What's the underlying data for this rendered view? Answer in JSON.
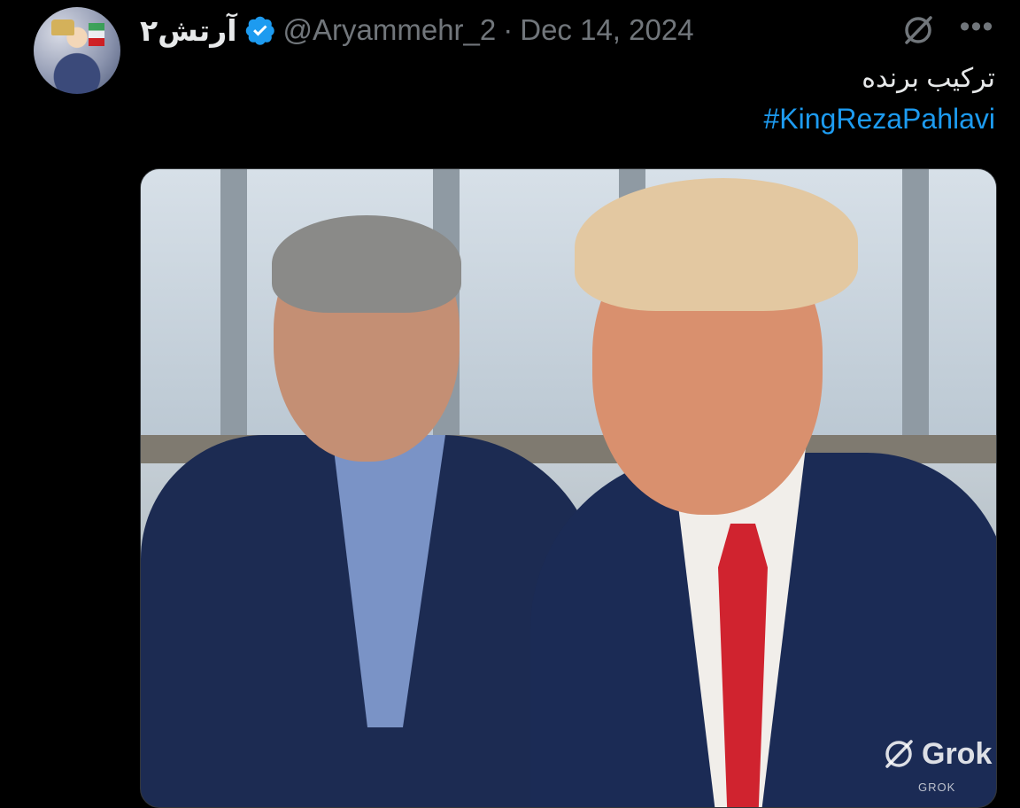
{
  "tweet": {
    "display_name": "آرتش۲",
    "handle": "@Aryammehr_2",
    "separator": "·",
    "date": "Dec 14, 2024",
    "text": "ترکیب برنده",
    "hashtag": "#KingRezaPahlavi",
    "verified": true
  },
  "media": {
    "watermark": "Grok",
    "watermark_small": "GROK"
  },
  "icons": {
    "grok_action": "grok-icon",
    "more": "more-icon",
    "verified": "verified-badge-icon"
  },
  "colors": {
    "background": "#000000",
    "text": "#e7e9ea",
    "muted": "#71767b",
    "link": "#1d9bf0",
    "verified": "#1d9bf0"
  }
}
